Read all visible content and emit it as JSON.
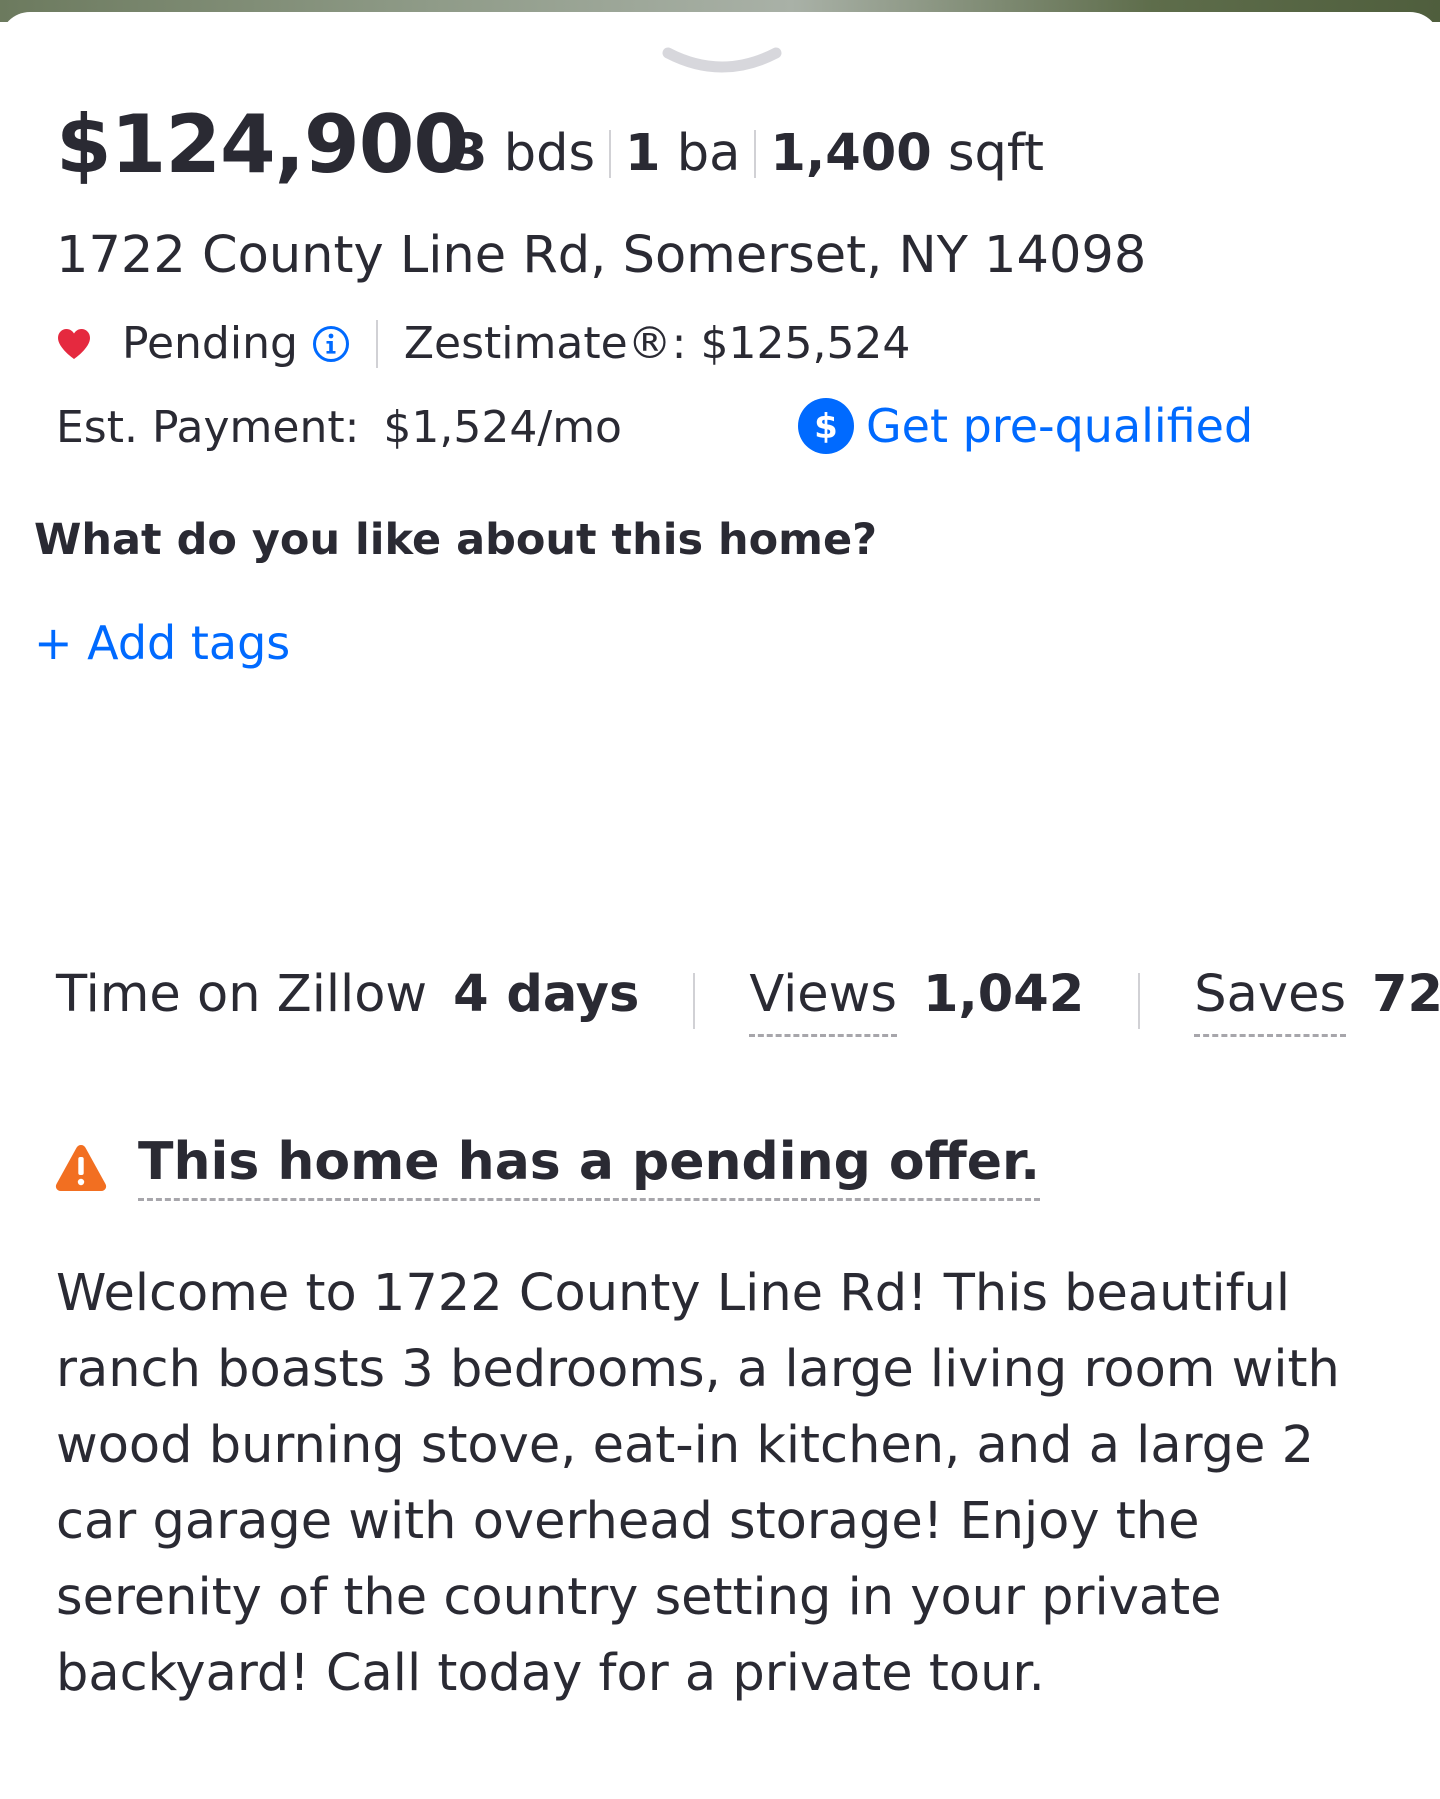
{
  "listing": {
    "price": "$124,900",
    "beds_value": "3",
    "beds_unit": "bds",
    "baths_value": "1",
    "baths_unit": "ba",
    "sqft_value": "1,400",
    "sqft_unit": "sqft",
    "address": "1722 County Line Rd, Somerset, NY 14098",
    "status": "Pending",
    "zestimate": "Zestimate®: $125,524",
    "est_payment_label": "Est. Payment:",
    "est_payment_value": "$1,524/mo",
    "prequal_label": "Get pre-qualified"
  },
  "tags": {
    "question": "What do you like about this home?",
    "add_label": "+ Add tags"
  },
  "stats": {
    "time_label": "Time on Zillow",
    "time_value": "4 days",
    "views_label": "Views",
    "views_value": "1,042",
    "saves_label": "Saves",
    "saves_value": "72"
  },
  "alert": {
    "text": "This home has a pending offer."
  },
  "description": "Welcome to 1722 County Line Rd! This beautiful ranch boasts 3 bedrooms, a large living room with wood burning stove, eat-in kitchen, and a large 2 car garage with overhead storage!  Enjoy the serenity of the country setting in your private backyard! Call today for a private tour.",
  "icons": {
    "handle": "chevron-down-icon",
    "status": "heart-icon",
    "status_info": "info-icon",
    "prequal": "dollar-icon",
    "alert": "warning-icon"
  },
  "colors": {
    "accent_blue": "#006aff",
    "heart_red": "#e5293f",
    "warning_orange": "#f26f21",
    "text_dark": "#2a2a33"
  }
}
